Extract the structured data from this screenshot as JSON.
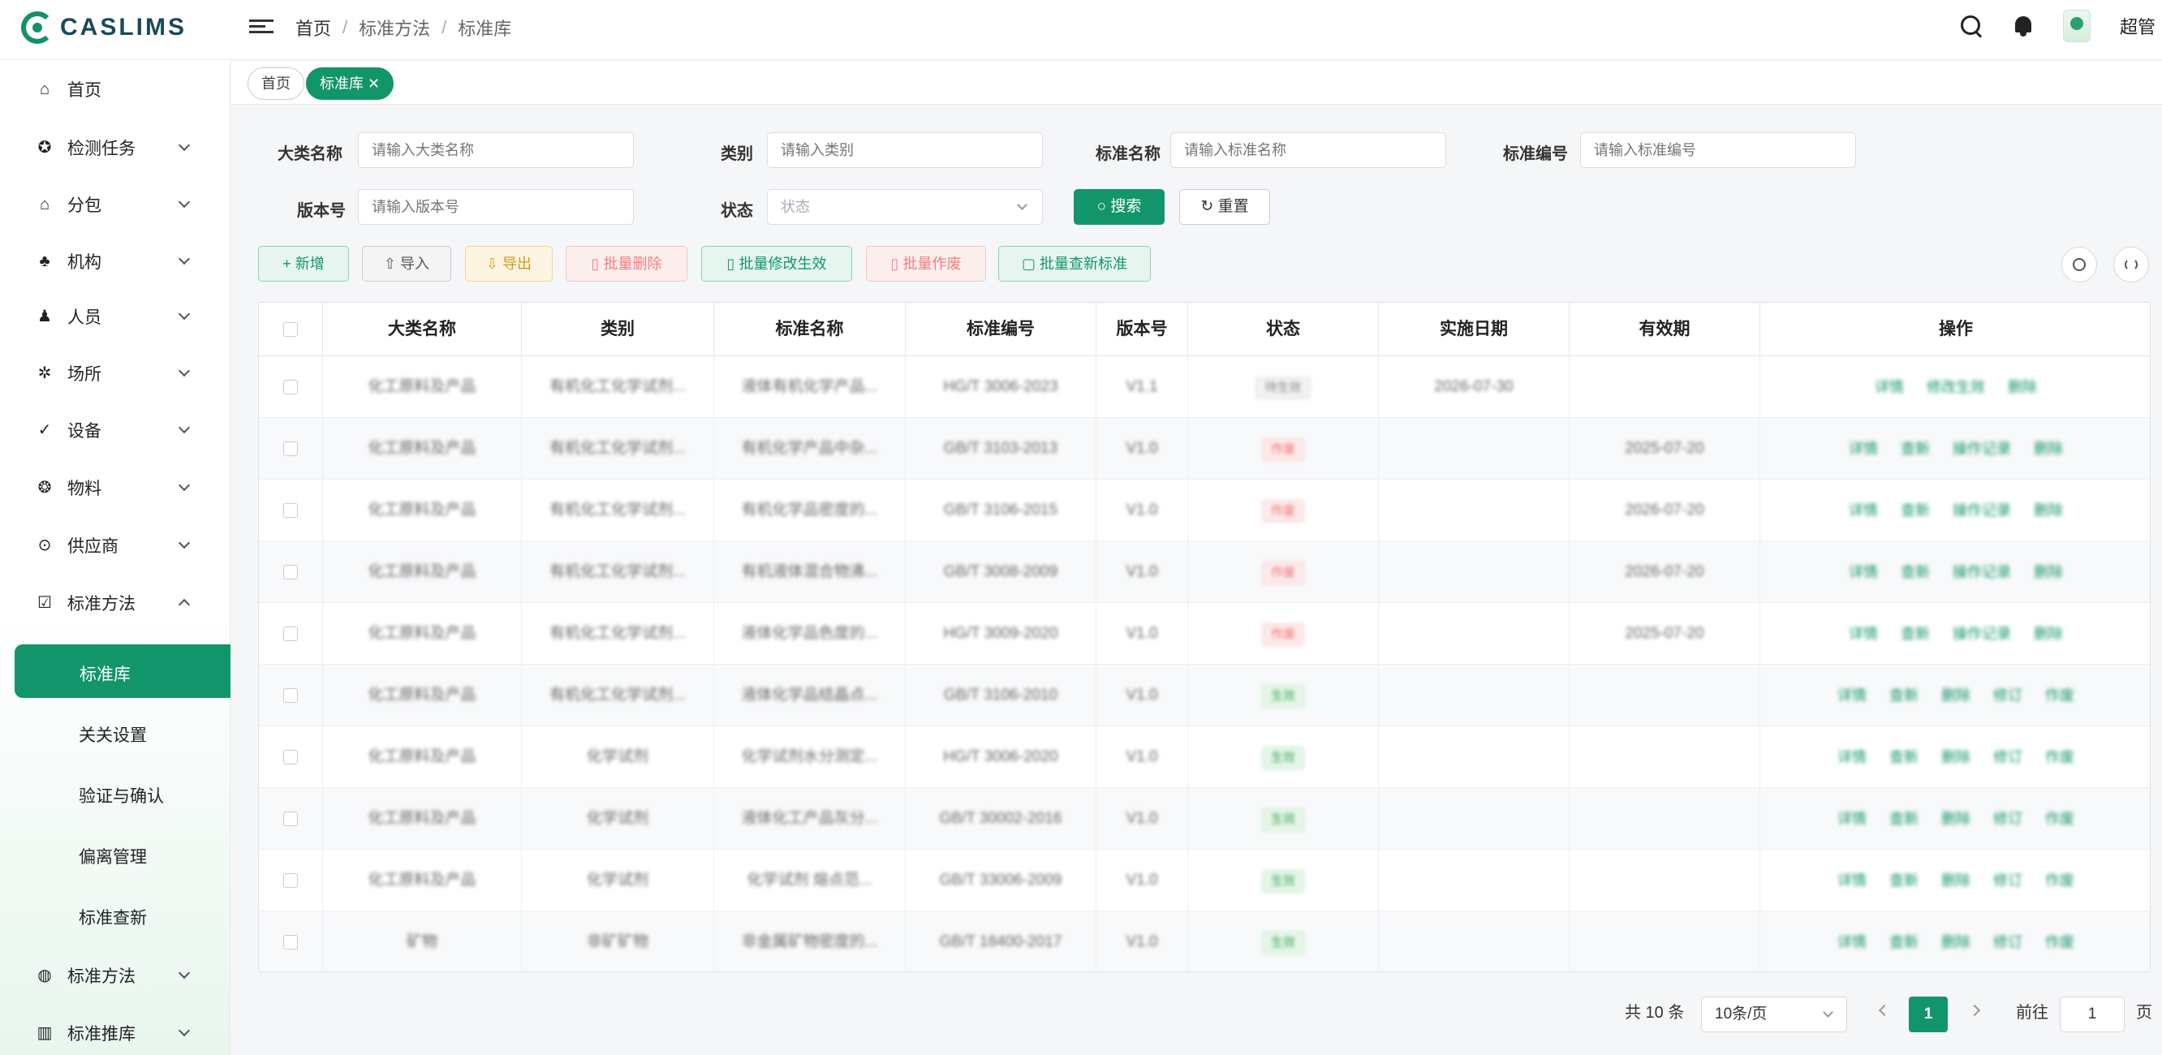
{
  "app": {
    "logo_text": "CASLIMS"
  },
  "breadcrumb": [
    "首页",
    "标准方法",
    "标准库"
  ],
  "header": {
    "user_name": "超管"
  },
  "sidebar": {
    "items": [
      {
        "label": "首页",
        "icon": "home-icon"
      },
      {
        "label": "检测任务",
        "icon": "task-icon"
      },
      {
        "label": "分包",
        "icon": "package-icon"
      },
      {
        "label": "机构",
        "icon": "org-icon"
      },
      {
        "label": "人员",
        "icon": "people-icon"
      },
      {
        "label": "场所",
        "icon": "place-icon"
      },
      {
        "label": "设备",
        "icon": "check-icon"
      },
      {
        "label": "物料",
        "icon": "material-icon"
      },
      {
        "label": "供应商",
        "icon": "supplier-icon"
      },
      {
        "label": "标准方法",
        "icon": "standard-icon"
      },
      {
        "label": "标准方法",
        "icon": "globe-icon"
      },
      {
        "label": "标准推库",
        "icon": "book-icon"
      }
    ],
    "sub_items": [
      "标准库",
      "关关设置",
      "验证与确认",
      "偏离管理",
      "标准查新"
    ]
  },
  "tags": {
    "home": "首页",
    "current": "标准库 ✕"
  },
  "filters": {
    "category": {
      "label": "大类名称",
      "placeholder": "请输入大类名称"
    },
    "type": {
      "label": "类别",
      "placeholder": "请输入类别"
    },
    "std_name": {
      "label": "标准名称",
      "placeholder": "请输入标准名称"
    },
    "std_no": {
      "label": "标准编号",
      "placeholder": "请输入标准编号"
    },
    "version": {
      "label": "版本号",
      "placeholder": "请输入版本号"
    },
    "status": {
      "label": "状态",
      "placeholder": "状态"
    },
    "search_btn": "搜索",
    "reset_btn": "重置"
  },
  "actions": {
    "add": "+ 新增",
    "import": "⇧ 导入",
    "export": "⇩ 导出",
    "batch_delete": "▯ 批量删除",
    "batch_update": "▯ 批量修改生效",
    "batch_void": "▯ 批量作废",
    "batch_search": "▢ 批量查新标准"
  },
  "table": {
    "columns": [
      "",
      "大类名称",
      "类别",
      "标准名称",
      "标准编号",
      "版本号",
      "状态",
      "实施日期",
      "有效期",
      "操作"
    ],
    "rows": [
      {
        "category": "化工原料及产品",
        "type": "有机化工化学试剂...",
        "name": "液体有机化学产品...",
        "no": "HG/T 3006-2023",
        "version": "V1.1",
        "status": "待生效",
        "status_color": "#888888",
        "impl_date": "2026-07-30",
        "valid": "",
        "ops": [
          "详情",
          "修改生效",
          "删除"
        ]
      },
      {
        "category": "化工原料及产品",
        "type": "有机化工化学试剂...",
        "name": "有机化学产品中杂...",
        "no": "GB/T 3103-2013",
        "version": "V1.0",
        "status": "作废",
        "status_color": "#ee6b6b",
        "impl_date": "",
        "valid": "2025-07-20",
        "ops": [
          "详情",
          "查新",
          "操作记录",
          "删除"
        ]
      },
      {
        "category": "化工原料及产品",
        "type": "有机化工化学试剂...",
        "name": "有机化学品密度的...",
        "no": "GB/T 3106-2015",
        "version": "V1.0",
        "status": "作废",
        "status_color": "#ee6b6b",
        "impl_date": "",
        "valid": "2026-07-20",
        "ops": [
          "详情",
          "查新",
          "操作记录",
          "删除"
        ]
      },
      {
        "category": "化工原料及产品",
        "type": "有机化工化学试剂...",
        "name": "有机液体混合物沸...",
        "no": "GB/T 3008-2009",
        "version": "V1.0",
        "status": "作废",
        "status_color": "#ee6b6b",
        "impl_date": "",
        "valid": "2026-07-20",
        "ops": [
          "详情",
          "查新",
          "操作记录",
          "删除"
        ]
      },
      {
        "category": "化工原料及产品",
        "type": "有机化工化学试剂...",
        "name": "液体化学品色度的...",
        "no": "HG/T 3009-2020",
        "version": "V1.0",
        "status": "作废",
        "status_color": "#ee6b6b",
        "impl_date": "",
        "valid": "2025-07-20",
        "ops": [
          "详情",
          "查新",
          "操作记录",
          "删除"
        ]
      },
      {
        "category": "化工原料及产品",
        "type": "有机化工化学试剂...",
        "name": "液体化学品结晶点...",
        "no": "GB/T 3106-2010",
        "version": "V1.0",
        "status": "生效",
        "status_color": "#3aa65a",
        "impl_date": "",
        "valid": "",
        "ops": [
          "详情",
          "查新",
          "删除",
          "修订",
          "作废"
        ]
      },
      {
        "category": "化工原料及产品",
        "type": "化学试剂",
        "name": "化学试剂水分测定...",
        "no": "HG/T 3006-2020",
        "version": "V1.0",
        "status": "生效",
        "status_color": "#3aa65a",
        "impl_date": "",
        "valid": "",
        "ops": [
          "详情",
          "查新",
          "删除",
          "修订",
          "作废"
        ]
      },
      {
        "category": "化工原料及产品",
        "type": "化学试剂",
        "name": "液体化工产品灰分...",
        "no": "GB/T 30002-2016",
        "version": "V1.0",
        "status": "生效",
        "status_color": "#3aa65a",
        "impl_date": "",
        "valid": "",
        "ops": [
          "详情",
          "查新",
          "删除",
          "修订",
          "作废"
        ]
      },
      {
        "category": "化工原料及产品",
        "type": "化学试剂",
        "name": "化学试剂 熔点范...",
        "no": "GB/T 33006-2009",
        "version": "V1.0",
        "status": "生效",
        "status_color": "#3aa65a",
        "impl_date": "",
        "valid": "",
        "ops": [
          "详情",
          "查新",
          "删除",
          "修订",
          "作废"
        ]
      },
      {
        "category": "矿物",
        "type": "非矿矿物",
        "name": "非金属矿物密度的...",
        "no": "GB/T 18400-2017",
        "version": "V1.0",
        "status": "生效",
        "status_color": "#3aa65a",
        "impl_date": "",
        "valid": "",
        "ops": [
          "详情",
          "查新",
          "删除",
          "修订",
          "作废"
        ]
      }
    ]
  },
  "pagination": {
    "total": "共 10 条",
    "page_size": "10条/页",
    "current": "1",
    "goto_prefix": "前往",
    "goto_value": "1",
    "goto_suffix": "页"
  },
  "colors": {
    "primary": "#13956b",
    "danger": "#ee6b6b",
    "success": "#3aa65a",
    "warning": "#d39a17"
  }
}
